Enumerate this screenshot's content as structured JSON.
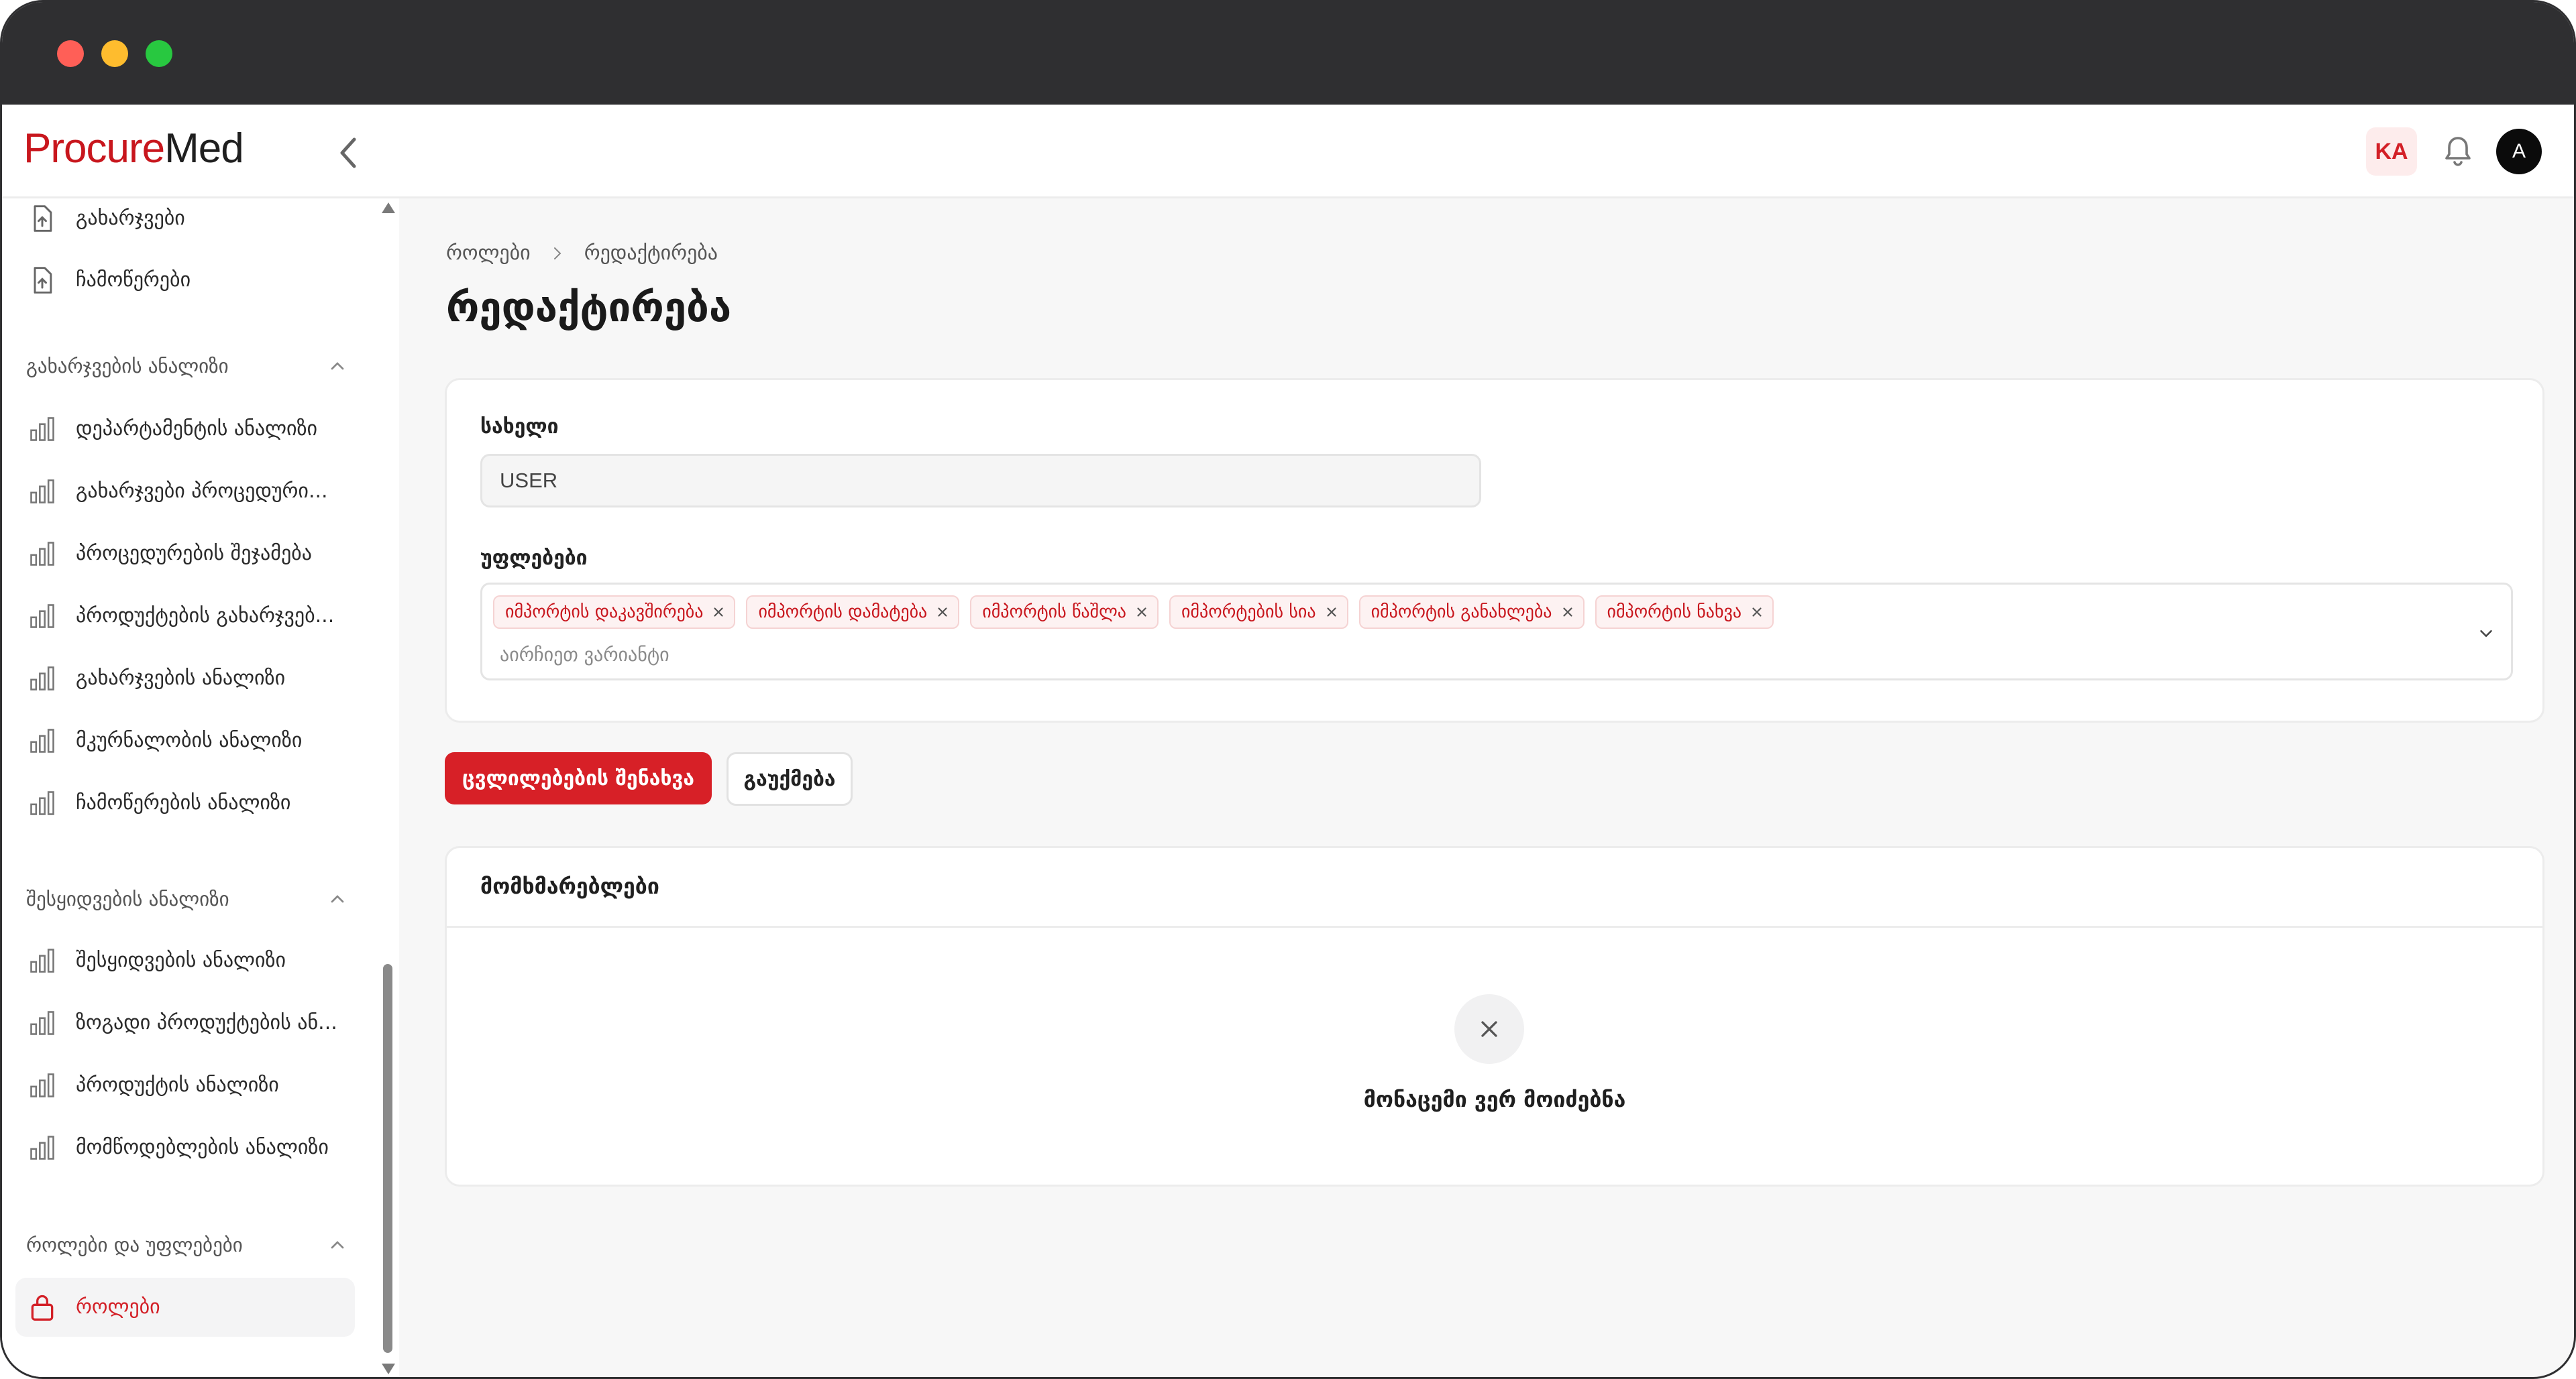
{
  "app": {
    "logo_part1": "Procure",
    "logo_part2": "Med",
    "language": "KA",
    "avatar_initial": "A"
  },
  "sidebar": {
    "top_items": [
      {
        "label": "გახარჯვები",
        "icon": "file-upload-icon"
      },
      {
        "label": "ჩამოწერები",
        "icon": "file-upload-icon"
      }
    ],
    "groups": [
      {
        "title": "გახარჯვების ანალიზი",
        "items": [
          {
            "label": "დეპარტამენტის ანალიზი",
            "icon": "bar-chart-icon"
          },
          {
            "label": "გახარჯვები პროცედური...",
            "icon": "bar-chart-icon"
          },
          {
            "label": "პროცედურების შეჯამება",
            "icon": "bar-chart-icon"
          },
          {
            "label": "პროდუქტების გახარჯვებ...",
            "icon": "bar-chart-icon"
          },
          {
            "label": "გახარჯვების ანალიზი",
            "icon": "bar-chart-icon"
          },
          {
            "label": "მკურნალობის ანალიზი",
            "icon": "bar-chart-icon"
          },
          {
            "label": "ჩამოწერების ანალიზი",
            "icon": "bar-chart-icon"
          }
        ]
      },
      {
        "title": "შესყიდვების ანალიზი",
        "items": [
          {
            "label": "შესყიდვების ანალიზი",
            "icon": "bar-chart-icon"
          },
          {
            "label": "ზოგადი პროდუქტების ან...",
            "icon": "bar-chart-icon"
          },
          {
            "label": "პროდუქტის ანალიზი",
            "icon": "bar-chart-icon"
          },
          {
            "label": "მომწოდებლების ანალიზი",
            "icon": "bar-chart-icon"
          }
        ]
      },
      {
        "title": "როლები და უფლებები",
        "items": [
          {
            "label": "როლები",
            "icon": "lock-icon",
            "active": true
          }
        ]
      }
    ]
  },
  "main": {
    "breadcrumb": [
      "როლები",
      "რედაქტირება"
    ],
    "title": "რედაქტირება",
    "form": {
      "name_label": "სახელი",
      "name_value": "USER",
      "permissions_label": "უფლებები",
      "permissions": [
        "იმპორტის დაკავშირება",
        "იმპორტის დამატება",
        "იმპორტის წაშლა",
        "იმპორტების სია",
        "იმპორტის განახლება",
        "იმპორტის ნახვა"
      ],
      "permissions_placeholder": "აირჩიეთ ვარიანტი"
    },
    "buttons": {
      "save": "ცვლილებების შენახვა",
      "cancel": "გაუქმება"
    },
    "users": {
      "title": "მომხმარებლები",
      "empty_text": "მონაცემი ვერ მოიძებნა"
    }
  },
  "colors": {
    "accent": "#d72027",
    "chip_bg": "#fdf2f2",
    "chip_text": "#c8161d"
  }
}
